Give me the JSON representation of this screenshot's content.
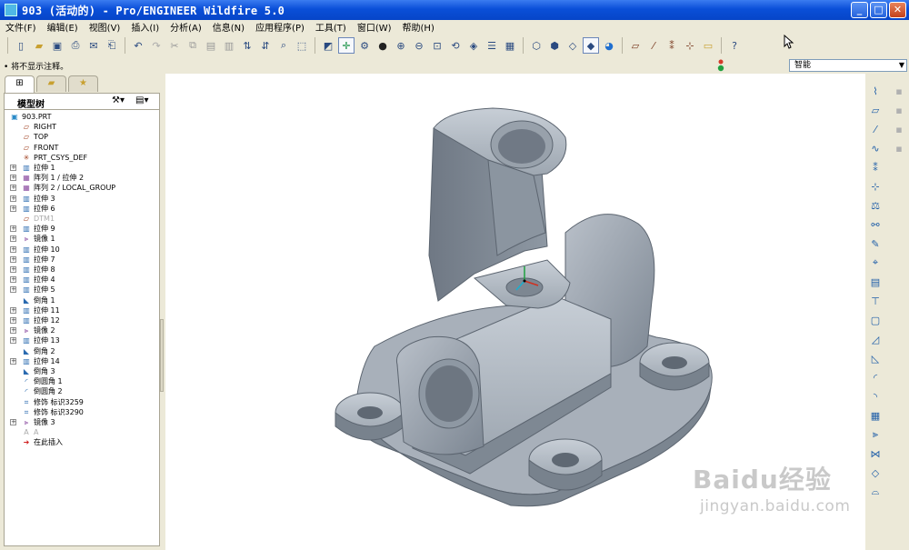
{
  "window": {
    "title": "903 (活动的) - Pro/ENGINEER Wildfire 5.0"
  },
  "menu": [
    {
      "id": "file",
      "label": "文件(F)"
    },
    {
      "id": "edit",
      "label": "编辑(E)"
    },
    {
      "id": "view",
      "label": "视图(V)"
    },
    {
      "id": "insert",
      "label": "插入(I)"
    },
    {
      "id": "analysis",
      "label": "分析(A)"
    },
    {
      "id": "info",
      "label": "信息(N)"
    },
    {
      "id": "apps",
      "label": "应用程序(P)"
    },
    {
      "id": "tools",
      "label": "工具(T)"
    },
    {
      "id": "window",
      "label": "窗口(W)"
    },
    {
      "id": "help",
      "label": "帮助(H)"
    }
  ],
  "toolbar_icons": [
    "new",
    "open",
    "save",
    "print",
    "email",
    "print-preview",
    "undo",
    "redo",
    "cut",
    "copy",
    "paste",
    "paste-special",
    "regenerate",
    "regenerate-manager",
    "find",
    "select-box",
    "repaint",
    "spin-center",
    "orient",
    "display-style",
    "zoom-in",
    "zoom-out",
    "zoom-fit",
    "reorient",
    "saved-views",
    "layers",
    "view-manager",
    "wireframe",
    "hidden-line",
    "no-hidden",
    "shading",
    "enhanced-realism",
    "datum-planes",
    "datum-axes",
    "datum-points",
    "csys",
    "annotations",
    "whats-this"
  ],
  "status": {
    "message": "将不显示注释。",
    "filter_value": "智能"
  },
  "model_tree": {
    "tabs": [
      "model-tree",
      "folder-browser",
      "favorites"
    ],
    "header": "模型树",
    "items": [
      {
        "label": "903.PRT",
        "icon": "part",
        "expandable": false,
        "indent": 0,
        "dim": false
      },
      {
        "label": "RIGHT",
        "icon": "plane",
        "expandable": false,
        "indent": 1,
        "dim": false
      },
      {
        "label": "TOP",
        "icon": "plane",
        "expandable": false,
        "indent": 1,
        "dim": false
      },
      {
        "label": "FRONT",
        "icon": "plane",
        "expandable": false,
        "indent": 1,
        "dim": false
      },
      {
        "label": "PRT_CSYS_DEF",
        "icon": "csys",
        "expandable": false,
        "indent": 1,
        "dim": false
      },
      {
        "label": "拉伸 1",
        "icon": "extrude",
        "expandable": true,
        "indent": 1,
        "dim": false
      },
      {
        "label": "阵列 1 / 拉伸 2",
        "icon": "pattern",
        "expandable": true,
        "indent": 1,
        "dim": false
      },
      {
        "label": "阵列 2 / LOCAL_GROUP",
        "icon": "pattern",
        "expandable": true,
        "indent": 1,
        "dim": false
      },
      {
        "label": "拉伸 3",
        "icon": "extrude",
        "expandable": true,
        "indent": 1,
        "dim": false
      },
      {
        "label": "拉伸 6",
        "icon": "extrude",
        "expandable": true,
        "indent": 1,
        "dim": false
      },
      {
        "label": "DTM1",
        "icon": "plane",
        "expandable": false,
        "indent": 1,
        "dim": true
      },
      {
        "label": "拉伸 9",
        "icon": "extrude",
        "expandable": true,
        "indent": 1,
        "dim": false
      },
      {
        "label": "镜像 1",
        "icon": "mirror",
        "expandable": true,
        "indent": 1,
        "dim": false
      },
      {
        "label": "拉伸 10",
        "icon": "extrude",
        "expandable": true,
        "indent": 1,
        "dim": false
      },
      {
        "label": "拉伸 7",
        "icon": "extrude",
        "expandable": true,
        "indent": 1,
        "dim": false
      },
      {
        "label": "拉伸 8",
        "icon": "extrude",
        "expandable": true,
        "indent": 1,
        "dim": false
      },
      {
        "label": "拉伸 4",
        "icon": "extrude",
        "expandable": true,
        "indent": 1,
        "dim": false
      },
      {
        "label": "拉伸 5",
        "icon": "extrude",
        "expandable": true,
        "indent": 1,
        "dim": false
      },
      {
        "label": "倒角 1",
        "icon": "chamfer",
        "expandable": false,
        "indent": 1,
        "dim": false
      },
      {
        "label": "拉伸 11",
        "icon": "extrude",
        "expandable": true,
        "indent": 1,
        "dim": false
      },
      {
        "label": "拉伸 12",
        "icon": "extrude",
        "expandable": true,
        "indent": 1,
        "dim": false
      },
      {
        "label": "镜像 2",
        "icon": "mirror",
        "expandable": true,
        "indent": 1,
        "dim": false
      },
      {
        "label": "拉伸 13",
        "icon": "extrude",
        "expandable": true,
        "indent": 1,
        "dim": false
      },
      {
        "label": "倒角 2",
        "icon": "chamfer",
        "expandable": false,
        "indent": 1,
        "dim": false
      },
      {
        "label": "拉伸 14",
        "icon": "extrude",
        "expandable": true,
        "indent": 1,
        "dim": false
      },
      {
        "label": "倒角 3",
        "icon": "chamfer",
        "expandable": false,
        "indent": 1,
        "dim": false
      },
      {
        "label": "倒圆角 1",
        "icon": "round",
        "expandable": false,
        "indent": 1,
        "dim": false
      },
      {
        "label": "倒圆角 2",
        "icon": "round",
        "expandable": false,
        "indent": 1,
        "dim": false
      },
      {
        "label": "修饰 标识3259",
        "icon": "cosmetic",
        "expandable": false,
        "indent": 1,
        "dim": false
      },
      {
        "label": "修饰 标识3290",
        "icon": "cosmetic",
        "expandable": false,
        "indent": 1,
        "dim": false
      },
      {
        "label": "镜像 3",
        "icon": "mirror",
        "expandable": true,
        "indent": 1,
        "dim": false
      },
      {
        "label": "A",
        "icon": "annotation",
        "expandable": false,
        "indent": 1,
        "dim": true
      },
      {
        "label": "在此插入",
        "icon": "insert-here",
        "expandable": false,
        "indent": 1,
        "dim": false
      }
    ]
  },
  "right_toolbar": [
    "sketched-datum-curve",
    "datum-plane",
    "datum-axis",
    "datum-curve",
    "datum-point",
    "datum-csys",
    "analysis-feature",
    "link",
    "sketch",
    "style",
    "datum-table",
    "hole",
    "shell",
    "rib",
    "draft",
    "round",
    "chamfer",
    "pattern",
    "mirror",
    "merge",
    "trim",
    "boundary-blend"
  ],
  "watermark": {
    "brand": "Baidu",
    "brand_cn": "经验",
    "url": "jingyan.baidu.com"
  }
}
